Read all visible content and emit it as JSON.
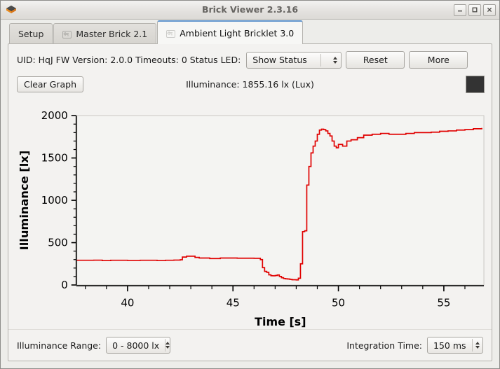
{
  "window": {
    "title": "Brick Viewer 2.3.16",
    "icon": "brick-icon",
    "controls": [
      {
        "name": "minimize-button",
        "glyph": "–"
      },
      {
        "name": "maximize-button",
        "glyph": "□"
      },
      {
        "name": "close-button",
        "glyph": "✕"
      }
    ]
  },
  "tabs": [
    {
      "label": "Setup",
      "icon": null,
      "active": false
    },
    {
      "label": "Master Brick 2.1",
      "icon": "back-arrow-icon",
      "active": false
    },
    {
      "label": "Ambient Light Bricklet 3.0",
      "icon": "back-arrow-icon",
      "active": true
    }
  ],
  "device_info": {
    "text": "UID:  HqJ  FW Version: 2.0.0  Timeouts: 0  Status LED:",
    "uid_label": "UID:",
    "uid_value": "HqJ",
    "fw_label": "FW Version:",
    "fw_value": "2.0.0",
    "timeouts_label": "Timeouts:",
    "timeouts_value": "0",
    "status_led_label": "Status LED:",
    "status_led_value": "Show Status",
    "reset_label": "Reset",
    "more_label": "More"
  },
  "graph_bar": {
    "clear_label": "Clear Graph",
    "reading": "Illuminance: 1855.16 lx (Lux)",
    "swatch_color": "#333333"
  },
  "footer": {
    "range_label": "Illuminance Range:",
    "range_value": "0 - 8000 lx",
    "integration_label": "Integration Time:",
    "integration_value": "150 ms"
  },
  "chart_data": {
    "type": "line",
    "title": "",
    "xlabel": "Time [s]",
    "ylabel": "Illuminance [lx]",
    "xlim": [
      37.6,
      56.9
    ],
    "ylim": [
      0,
      2000
    ],
    "xticks": [
      40,
      45,
      50,
      55
    ],
    "yticks": [
      0,
      500,
      1000,
      1500,
      2000
    ],
    "xminor_step": 1,
    "yminor_step": 100,
    "grid": false,
    "legend": null,
    "series": [
      {
        "name": "Illuminance",
        "color": "#e00000",
        "x": [
          37.6,
          38.0,
          38.4,
          38.8,
          39.0,
          39.2,
          39.6,
          40.0,
          40.4,
          40.6,
          41.0,
          41.4,
          41.6,
          41.8,
          42.0,
          42.2,
          42.4,
          42.5,
          42.6,
          42.8,
          43.0,
          43.2,
          43.4,
          43.6,
          43.9,
          44.2,
          44.4,
          44.8,
          45.2,
          45.6,
          46.0,
          46.2,
          46.3,
          46.4,
          46.5,
          46.6,
          46.7,
          46.8,
          46.9,
          47.0,
          47.1,
          47.2,
          47.3,
          47.4,
          47.5,
          47.6,
          47.7,
          47.8,
          47.9,
          48.0,
          48.1,
          48.2,
          48.3,
          48.4,
          48.5,
          48.6,
          48.7,
          48.8,
          48.9,
          49.0,
          49.1,
          49.2,
          49.3,
          49.4,
          49.5,
          49.6,
          49.7,
          49.8,
          49.9,
          50.0,
          50.2,
          50.4,
          50.6,
          50.9,
          51.2,
          51.6,
          52.0,
          52.4,
          52.8,
          53.2,
          53.6,
          54.0,
          54.4,
          54.8,
          55.2,
          55.6,
          56.0,
          56.4,
          56.8
        ],
        "y": [
          292,
          292,
          293,
          288,
          288,
          292,
          292,
          290,
          290,
          292,
          292,
          289,
          289,
          292,
          292,
          294,
          294,
          298,
          330,
          340,
          340,
          326,
          318,
          318,
          312,
          312,
          318,
          318,
          316,
          316,
          315,
          315,
          300,
          205,
          160,
          150,
          120,
          110,
          108,
          112,
          118,
          100,
          86,
          76,
          72,
          70,
          66,
          62,
          62,
          60,
          80,
          250,
          630,
          640,
          1180,
          1400,
          1560,
          1640,
          1700,
          1780,
          1830,
          1840,
          1835,
          1820,
          1790,
          1760,
          1700,
          1640,
          1620,
          1660,
          1640,
          1700,
          1715,
          1740,
          1770,
          1780,
          1790,
          1780,
          1780,
          1790,
          1800,
          1800,
          1805,
          1815,
          1820,
          1830,
          1835,
          1845,
          1855
        ]
      }
    ]
  }
}
